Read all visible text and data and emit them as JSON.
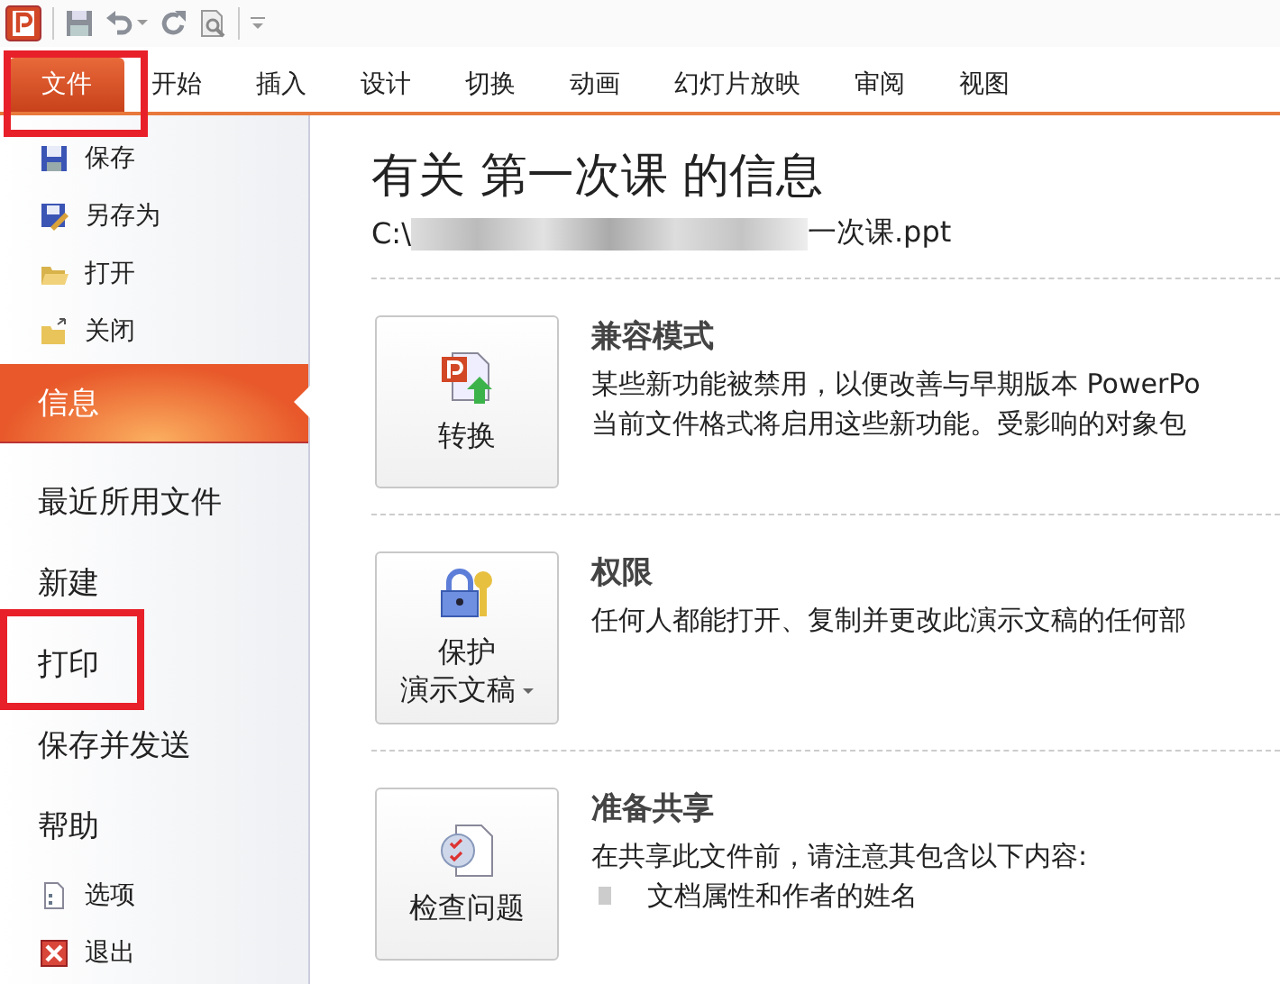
{
  "ribbon_tabs": [
    {
      "label": "文件",
      "selected": true,
      "highlighted": true
    },
    {
      "label": "开始",
      "selected": false,
      "highlighted": false
    },
    {
      "label": "插入",
      "selected": false,
      "highlighted": false
    },
    {
      "label": "设计",
      "selected": false,
      "highlighted": false
    },
    {
      "label": "切换",
      "selected": false,
      "highlighted": false
    },
    {
      "label": "动画",
      "selected": false,
      "highlighted": false
    },
    {
      "label": "幻灯片放映",
      "selected": false,
      "highlighted": false
    },
    {
      "label": "审阅",
      "selected": false,
      "highlighted": false
    },
    {
      "label": "视图",
      "selected": false,
      "highlighted": false
    }
  ],
  "sidebar": {
    "items": [
      {
        "kind": "command",
        "label": "保存",
        "selected": false,
        "highlighted": false
      },
      {
        "kind": "command",
        "label": "另存为",
        "selected": false,
        "highlighted": false
      },
      {
        "kind": "command",
        "label": "打开",
        "selected": false,
        "highlighted": false
      },
      {
        "kind": "command",
        "label": "关闭",
        "selected": false,
        "highlighted": false
      },
      {
        "kind": "page",
        "label": "信息",
        "selected": true,
        "highlighted": false
      },
      {
        "kind": "page",
        "label": "最近所用文件",
        "selected": false,
        "highlighted": false
      },
      {
        "kind": "page",
        "label": "新建",
        "selected": false,
        "highlighted": false
      },
      {
        "kind": "page",
        "label": "打印",
        "selected": false,
        "highlighted": true
      },
      {
        "kind": "page",
        "label": "保存并发送",
        "selected": false,
        "highlighted": false
      },
      {
        "kind": "page",
        "label": "帮助",
        "selected": false,
        "highlighted": false
      },
      {
        "kind": "command",
        "label": "选项",
        "selected": false,
        "highlighted": false
      },
      {
        "kind": "command",
        "label": "退出",
        "selected": false,
        "highlighted": false
      }
    ]
  },
  "info": {
    "title": "有关 第一次课 的信息",
    "path_start": "C:\\",
    "path_end": "一次课.ppt",
    "sections": [
      {
        "button": [
          "转换"
        ],
        "heading": "兼容模式",
        "lines": [
          "某些新功能被禁用，以便改善与早期版本 PowerPo",
          "当前文件格式将启用这些新功能。受影响的对象包"
        ]
      },
      {
        "button": [
          "保护",
          "演示文稿"
        ],
        "dropdown": true,
        "heading": "权限",
        "lines": [
          "任何人都能打开、复制并更改此演示文稿的任何部"
        ]
      },
      {
        "button": [
          "检查问题"
        ],
        "heading": "准备共享",
        "lines": [
          "在共享此文件前，请注意其包含以下内容:"
        ],
        "bullets": [
          "文档属性和作者的姓名"
        ]
      }
    ]
  }
}
